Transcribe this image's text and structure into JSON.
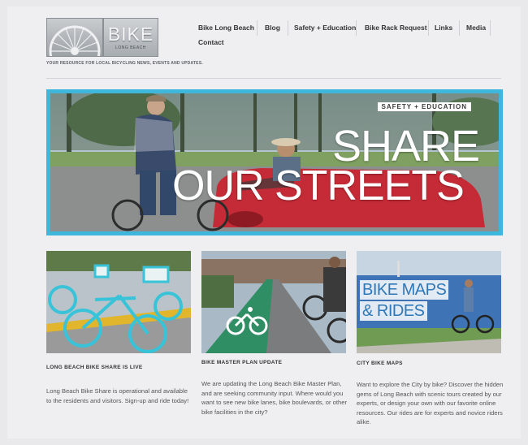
{
  "logo": {
    "big_text": "BIKE",
    "small_text": "LONG BEACH",
    "tagline": "YOUR RESOURCE FOR LOCAL BICYCLING NEWS, EVENTS AND UPDATES."
  },
  "nav": {
    "items": [
      "Bike Long Beach",
      "Blog",
      "Safety + Education",
      "Bike Rack Request",
      "Links",
      "Media",
      "Contact"
    ]
  },
  "hero": {
    "badge": "SAFETY + EDUCATION",
    "title_line1": "SHARE",
    "title_line2": "OUR STREETS",
    "accent_color": "#3fb6dc"
  },
  "cards": [
    {
      "title": "LONG BEACH BIKE SHARE IS LIVE",
      "text": "Long Beach Bike Share is operational and available to the residents and visitors. Sign-up and ride today!"
    },
    {
      "title": "BIKE MASTER PLAN UPDATE",
      "text": "We are updating the Long Beach Bike Master Plan, and are seeking community input. Where would you want to see new bike lanes, bike boulevards, or other bike facilities in the city?"
    },
    {
      "title": "CITY BIKE MAPS",
      "text": "Want to explore the City by bike? Discover the hidden gems of Long Beach with scenic tours created by our experts, or design your own with our favorite online resources. Our rides are for experts and novice riders alike.",
      "image_overlay_line1": "BIKE MAPS",
      "image_overlay_line2": "& RIDES"
    }
  ]
}
